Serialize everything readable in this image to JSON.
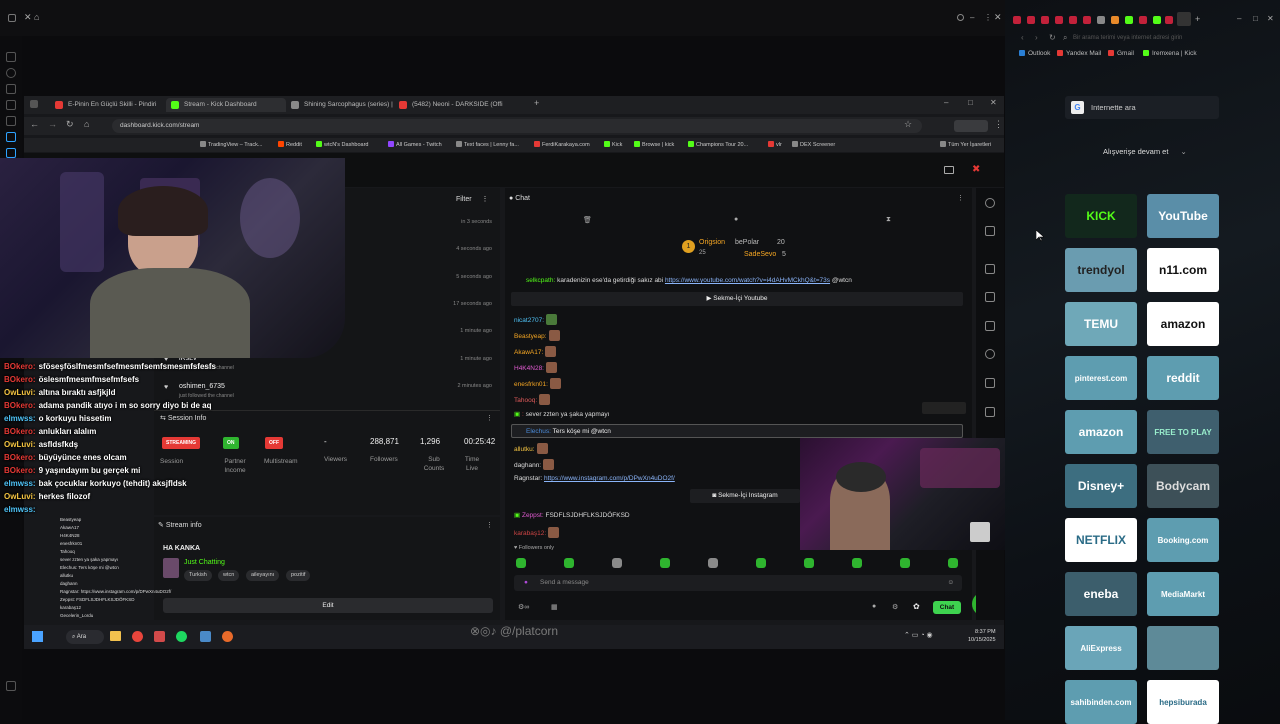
{
  "outer_bookmarks": [
    "Outlook",
    "Yandex Mail",
    "Gmail",
    "Iremxena | Kick"
  ],
  "right_panel": {
    "address_placeholder": "Bir arama terimi veya internet adresi girin",
    "search_label": "Internette ara",
    "shopping_label": "Alışverişe devam et",
    "tiles": [
      {
        "label": "KICK",
        "bg": "#12281c",
        "fg": "#53fc18"
      },
      {
        "label": "YouTube",
        "bg": "#5a8ea8",
        "fg": "#ffffff"
      },
      {
        "label": "trendyol",
        "bg": "#6a9cb0",
        "fg": "#222222"
      },
      {
        "label": "n11.com",
        "bg": "#ffffff",
        "fg": "#111111"
      },
      {
        "label": "TEMU",
        "bg": "#6fa8b8",
        "fg": "#ffffff"
      },
      {
        "label": "amazon",
        "bg": "#ffffff",
        "fg": "#111111"
      },
      {
        "label": "pinterest.com",
        "bg": "#5e9db0",
        "fg": "#ffffff"
      },
      {
        "label": "reddit",
        "bg": "#5e9db0",
        "fg": "#ffffff"
      },
      {
        "label": "amazon",
        "bg": "#5e9db0",
        "fg": "#ffffff"
      },
      {
        "label": "FREE TO PLAY",
        "bg": "#3f5f6e",
        "fg": "#9ec"
      },
      {
        "label": "Disney+",
        "bg": "#3d6e80",
        "fg": "#ffffff"
      },
      {
        "label": "Bodycam",
        "bg": "#3d5058",
        "fg": "#dddddd"
      },
      {
        "label": "NETFLIX",
        "bg": "#ffffff",
        "fg": "#2a6b86"
      },
      {
        "label": "Booking.com",
        "bg": "#5e9db0",
        "fg": "#ffffff"
      },
      {
        "label": "eneba",
        "bg": "#3c5e6c",
        "fg": "#ffffff"
      },
      {
        "label": "MediaMarkt",
        "bg": "#5e9db0",
        "fg": "#ffffff"
      },
      {
        "label": "AliExpress",
        "bg": "#6aa5b8",
        "fg": "#ffffff"
      },
      {
        "label": "",
        "bg": "#5e8a98",
        "fg": "#ffffff"
      },
      {
        "label": "sahibinden.com",
        "bg": "#5e9db0",
        "fg": "#ffffff"
      },
      {
        "label": "hepsiburada",
        "bg": "#ffffff",
        "fg": "#2a6b86"
      }
    ]
  },
  "inner_tabs": [
    {
      "label": "E-Pinin En Güçlü Skilli - Pindiri",
      "color": "#e53935"
    },
    {
      "label": "Stream - Kick Dashboard",
      "color": "#53fc18"
    },
    {
      "label": "Shining Sarcophagus (series) | ",
      "color": "#888888"
    },
    {
      "label": "(5482) Neoni - DARKSIDE (Offi",
      "color": "#e53935"
    }
  ],
  "inner_url": "dashboard.kick.com/stream",
  "inner_bookmarks": [
    "TradingView – Track...",
    "Reddit",
    "wtcN's Dashboard",
    "All Games - Twitch",
    "Text faces | Lenny fa...",
    "FerdiKarakaya.com",
    "Kick",
    "Browse | kick",
    "Champions Tour 20...",
    "vlr",
    "DEX Screener",
    "Tüm Yer İşaretleri"
  ],
  "activity": {
    "filter_label": "Filter",
    "timestamps": [
      "in 3 seconds",
      "4 seconds ago",
      "5 seconds ago",
      "17 seconds ago",
      "1 minute ago",
      "1 minute ago",
      "2 minutes ago"
    ],
    "follows": [
      {
        "name": "iRsLV",
        "action": "just followed the channel"
      },
      {
        "name": "oshimen_6735",
        "action": "just followed the channel"
      }
    ]
  },
  "session": {
    "title": "Session Info",
    "badges": [
      {
        "label": "STREAMING",
        "color": "#e53935"
      },
      {
        "label": "ON",
        "color": "#2fb52f"
      },
      {
        "label": "OFF",
        "color": "#e53935"
      }
    ],
    "values": [
      "-",
      "288,871",
      "1,296",
      "00:25:42"
    ],
    "labels": [
      "Session",
      "Partner Income",
      "Multistream",
      "Viewers",
      "Followers",
      "Sub Counts",
      "Time Live"
    ]
  },
  "stream_info": {
    "title": "Stream info",
    "stream_title": "HA KANKA",
    "category": "Just Chatting",
    "tags": [
      "Turkish",
      "wtcn",
      "aileyayını",
      "pozitif"
    ],
    "edit_label": "Edit"
  },
  "chat": {
    "title": "Chat",
    "leaders": [
      {
        "name": "Origsion",
        "value": "25"
      },
      {
        "name": "bePolar",
        "value": "20"
      },
      {
        "name": "SadeSevo",
        "value": "5"
      }
    ],
    "pinned_msg": {
      "user": "selkcpath:",
      "text": "karadenizin ese'da getirdiği sakız abi",
      "link": "https://www.youtube.com/watch?v=i4dAHvMCkhQ&t=73s",
      "tail": "@wtcn"
    },
    "youtube_btn": "Sekme-İçi Youtube",
    "emote_users": [
      "nicat2707:",
      "Beastyeap:",
      "AkawA17:",
      "H4K4N28:",
      "enesfrkn01:",
      "Tahooq:"
    ],
    "msg1": {
      "user": ":",
      "text": "sever zzten ya şaka yapmayı"
    },
    "reply": {
      "user": "Elechus:",
      "text": "Ters köşe mi @wtcn"
    },
    "emote_users2": [
      "allutku:",
      "daghann:"
    ],
    "ig_msg": {
      "user": "Ragnstar:",
      "link": "https://www.instagram.com/p/DPwXn4uDO2f/"
    },
    "ig_btn": "Sekme-İçi Instagram",
    "msg2": {
      "user": "Zeppst:",
      "text": "FSDFLSJDHFLKSJDÖFKSD"
    },
    "msg3_user": "karabaş12:",
    "followers_only": "Followers only",
    "input_placeholder": "Send a message",
    "send_label": "Chat"
  },
  "taskbar": {
    "search": "Ara",
    "time": "8:37 PM",
    "date": "10/15/2025"
  },
  "watermark": "@/platcorn",
  "overlay_chat": [
    {
      "user": "BOkero:",
      "text": "sföseşföslfmesmfsefmesmfsemfsmesmfsfesfs",
      "color": "#e53935"
    },
    {
      "user": "BOkero:",
      "text": "öslesmfmesmfmsefmfsefs",
      "color": "#e53935"
    },
    {
      "user": "OwLuvi:",
      "text": "altına bıraktı asfjkjld",
      "color": "#f5c542"
    },
    {
      "user": "BOkero:",
      "text": "adama pandik atıyo i m so sorry diyo bi de aq",
      "color": "#e53935"
    },
    {
      "user": "elmwss:",
      "text": "o korkuyu hissetim",
      "color": "#4fc3f7"
    },
    {
      "user": "BOkero:",
      "text": "anlukları alalım",
      "color": "#e53935"
    },
    {
      "user": "OwLuvi:",
      "text": "asfldsfkdş",
      "color": "#f5c542"
    },
    {
      "user": "BOkero:",
      "text": "büyüyünce enes olcam",
      "color": "#e53935"
    },
    {
      "user": "BOkero:",
      "text": "9 yaşındayım bu gerçek mi",
      "color": "#e53935"
    },
    {
      "user": "elmwss:",
      "text": "bak çocuklar korkuyo (tehdit) aksjfldsk",
      "color": "#4fc3f7"
    },
    {
      "user": "OwLuvi:",
      "text": "herkes filozof",
      "color": "#f5c542"
    },
    {
      "user": "elmwss:",
      "text": "",
      "color": "#4fc3f7"
    }
  ],
  "overlay_small": [
    "Beastyeap",
    "AkawA17",
    "H4K4N28",
    "enesfrkn01",
    "Tahooq",
    "sever zzten ya şaka yapmayı",
    "Elechus: Ters köşe mi @wtcn",
    "allutku",
    "daghann",
    "Ragnstar: https://www.instagram.com/p/DPwXn4uDO2f/",
    "Zeppst: FSDFLSJDHFLKSJDÖFKSD",
    "karabaş12",
    "Gecelerin_Lordu"
  ]
}
